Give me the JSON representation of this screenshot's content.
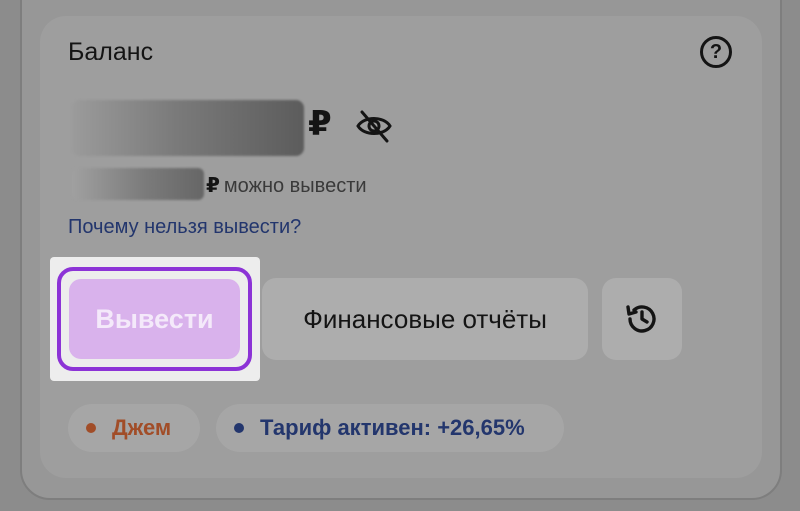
{
  "balance": {
    "title": "Баланс",
    "help_icon": "?",
    "currency": "₽",
    "withdrawable_currency": "₽",
    "withdrawable_label": "можно вывести",
    "why_link": "Почему нельзя вывести?"
  },
  "actions": {
    "withdraw_label": "Вывести",
    "reports_label": "Финансовые отчёты",
    "history_icon": "history-icon"
  },
  "chips": {
    "jam_label": "Джем",
    "tariff_label": "Тариф активен: +26,65%"
  },
  "colors": {
    "accent": "#8c33d6",
    "link": "#23366d",
    "jam": "#a14d28",
    "tariff": "#23366d"
  }
}
